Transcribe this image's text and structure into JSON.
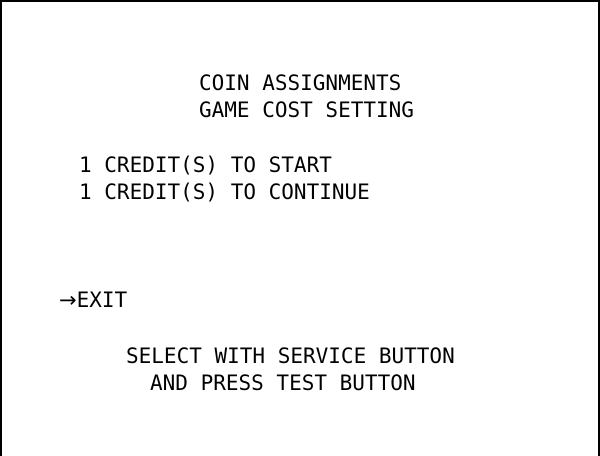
{
  "screen": {
    "title_line1": "COIN ASSIGNMENTS",
    "title_line2": "GAME COST SETTING",
    "options": [
      {
        "label": "1 CREDIT(S) TO START"
      },
      {
        "label": "1 CREDIT(S) TO CONTINUE"
      }
    ],
    "cursor": "→",
    "exit_label": "EXIT",
    "hint_line1": "SELECT WITH SERVICE BUTTON",
    "hint_line2": "AND PRESS TEST BUTTON"
  },
  "colors": {
    "background": "#ffffff",
    "text": "#000000"
  }
}
